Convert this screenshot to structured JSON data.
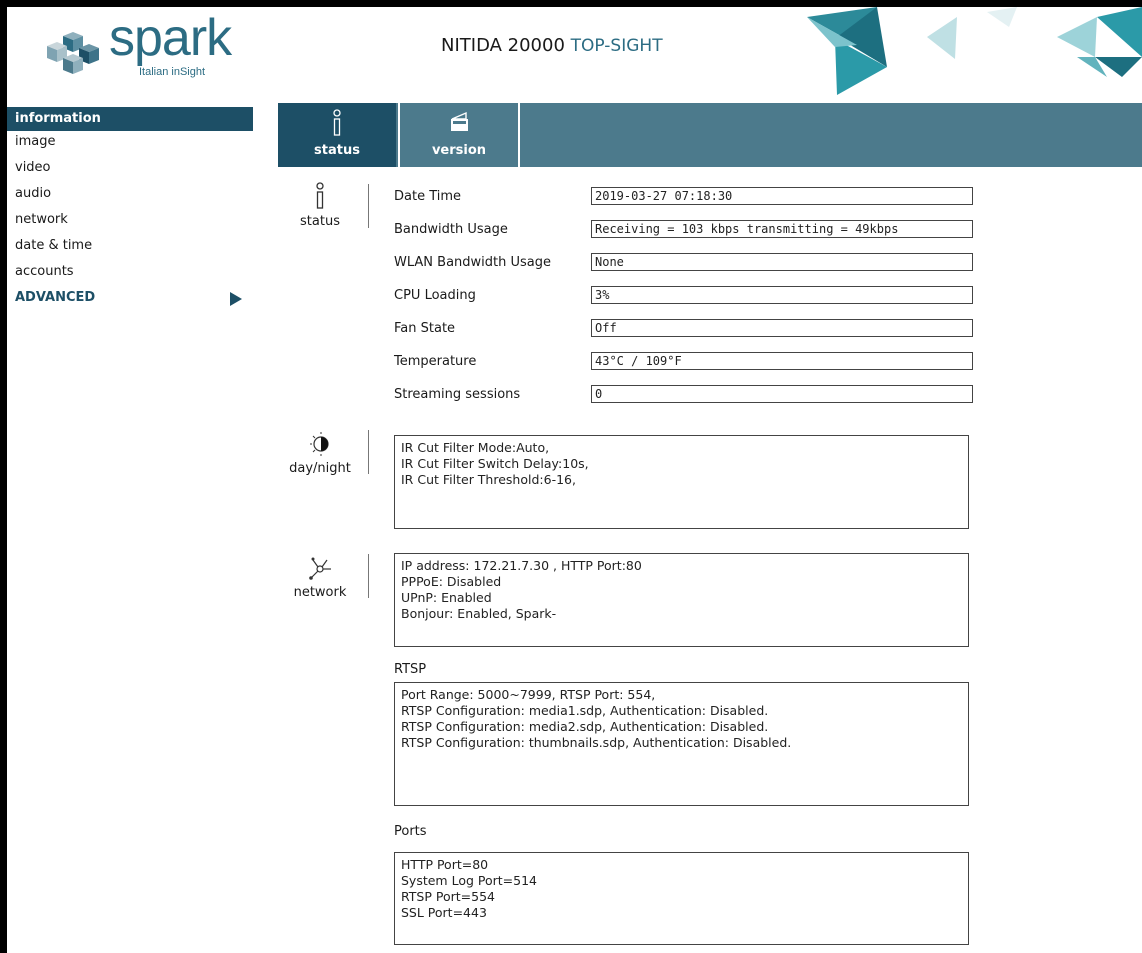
{
  "brand": {
    "name": "spark",
    "tagline": "Italian inSight"
  },
  "header": {
    "device_model": "NITIDA 20000",
    "device_variant": "TOP-SIGHT"
  },
  "colors": {
    "primary": "#1d4f66",
    "tab_bar": "#4c7a8c",
    "accent": "#2c6c83"
  },
  "sidebar": {
    "items": [
      {
        "label": "information",
        "active": true
      },
      {
        "label": "image"
      },
      {
        "label": "video"
      },
      {
        "label": "audio"
      },
      {
        "label": "network"
      },
      {
        "label": "date & time"
      },
      {
        "label": "accounts"
      },
      {
        "label": "ADVANCED",
        "icon": "play-arrow-icon"
      }
    ]
  },
  "tabs": [
    {
      "label": "status",
      "icon": "info-icon",
      "active": true
    },
    {
      "label": "version",
      "icon": "version-icon"
    }
  ],
  "status_section": {
    "label": "status",
    "icon": "info-icon",
    "fields": [
      {
        "label": "Date Time",
        "value": "2019-03-27   07:18:30"
      },
      {
        "label": "Bandwidth Usage",
        "value": "Receiving = 103 kbps transmitting = 49kbps"
      },
      {
        "label": "WLAN Bandwidth Usage",
        "value": "None"
      },
      {
        "label": "CPU Loading",
        "value": "3%"
      },
      {
        "label": "Fan State",
        "value": "Off"
      },
      {
        "label": "Temperature",
        "value": "43°C / 109°F"
      },
      {
        "label": "Streaming sessions",
        "value": "0"
      }
    ]
  },
  "daynight_section": {
    "label": "day/night",
    "icon": "day-night-icon",
    "text": "IR Cut Filter Mode:Auto,\nIR Cut Filter Switch Delay:10s,\nIR Cut Filter Threshold:6-16,"
  },
  "network_section": {
    "label": "network",
    "icon": "network-icon",
    "text": "IP address: 172.21.7.30 , HTTP Port:80\nPPPoE: Disabled\nUPnP: Enabled\nBonjour: Enabled, Spark-",
    "rtsp_label": "RTSP",
    "rtsp_text": "Port Range: 5000~7999, RTSP Port: 554,\nRTSP Configuration: media1.sdp, Authentication: Disabled.\nRTSP Configuration: media2.sdp, Authentication: Disabled.\nRTSP Configuration: thumbnails.sdp, Authentication: Disabled.",
    "ports_label": "Ports",
    "ports_text": "HTTP Port=80\nSystem Log Port=514\nRTSP Port=554\nSSL Port=443"
  }
}
